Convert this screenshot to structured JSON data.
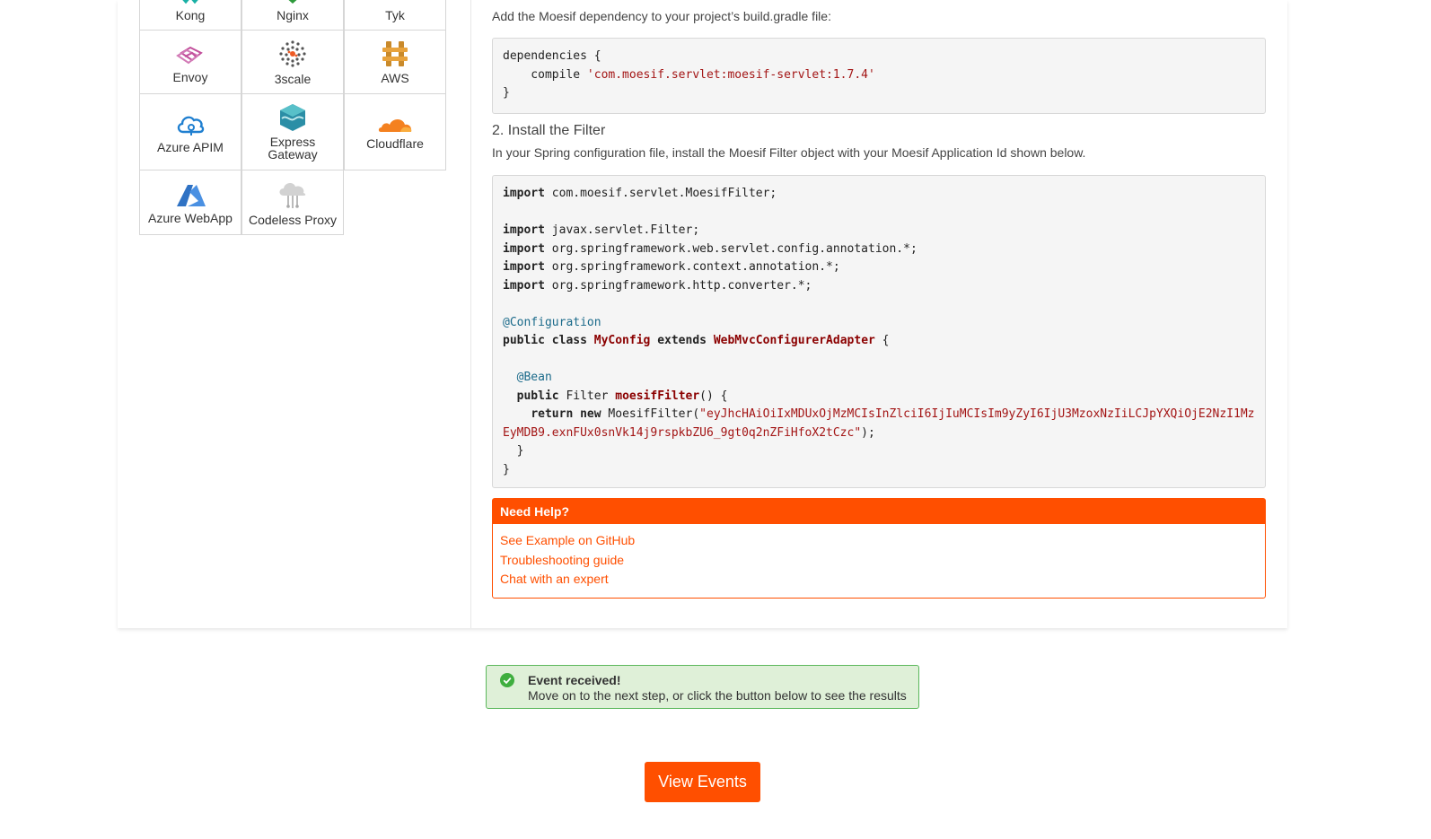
{
  "integrations": [
    {
      "label": "Kong",
      "icon": "kong-icon"
    },
    {
      "label": "Nginx",
      "icon": "nginx-icon"
    },
    {
      "label": "Tyk",
      "icon": "tyk-icon"
    },
    {
      "label": "Envoy",
      "icon": "envoy-icon"
    },
    {
      "label": "3scale",
      "icon": "3scale-icon"
    },
    {
      "label": "AWS",
      "icon": "aws-icon"
    },
    {
      "label": "Azure APIM",
      "icon": "azure-apim-icon"
    },
    {
      "label": "Express Gateway",
      "icon": "express-gateway-icon"
    },
    {
      "label": "Cloudflare",
      "icon": "cloudflare-icon"
    },
    {
      "label": "Azure WebApp",
      "icon": "azure-webapp-icon"
    },
    {
      "label": "Codeless Proxy",
      "icon": "codeless-proxy-icon"
    }
  ],
  "step1": {
    "instruction": "Add the Moesif dependency to your project’s build.gradle file:",
    "code": {
      "l1": "dependencies {",
      "l2_prefix": "    compile ",
      "l2_string": "'com.moesif.servlet:moesif-servlet:1.7.4'",
      "l3": "}"
    }
  },
  "step2": {
    "heading": "2. Install the Filter",
    "instruction": "In your Spring configuration file, install the Moesif Filter object with your Moesif Application Id shown below.",
    "code": {
      "kw_import": "import",
      "imp1": " com.moesif.servlet.MoesifFilter;",
      "imp2": " javax.servlet.Filter;",
      "imp3": " org.springframework.web.servlet.config.annotation.*;",
      "imp4": " org.springframework.context.annotation.*;",
      "imp5": " org.springframework.http.converter.*;",
      "ann_config": "@Configuration",
      "kw_public_class": "public class",
      "class_name": "MyConfig",
      "kw_extends": "extends",
      "parent_class": "WebMvcConfigurerAdapter",
      "open_brace": " {",
      "ann_bean": "@Bean",
      "kw_public": "public",
      "type_filter": " Filter ",
      "method_name": "moesifFilter",
      "method_tail": "() {",
      "kw_return_new": "return new",
      "ctor": " MoesifFilter(",
      "app_id_part1": "\"eyJhcHAiOiIxMDUxOjMzMCIsInZlciI6IjIuMCIsIm9yZyI6IjU3MzoxNzIiLCJpYXQiOjE2NzI1Mz",
      "app_id_part2": "EyMDB9.exnFUx0snVk14j9rspkbZU6_9gt0q2nZFiHfoX2tCzc\"",
      "ctor_close": ");",
      "inner_close": "  }",
      "outer_close": "}"
    }
  },
  "help": {
    "title": "Need Help?",
    "links": [
      "See Example on GitHub",
      "Troubleshooting guide",
      "Chat with an expert"
    ]
  },
  "alert": {
    "title": "Event received!",
    "message": "Move on to the next step, or click the button below to see the results"
  },
  "cta": {
    "label": "View Events"
  },
  "colors": {
    "accent": "#ff4f00",
    "success_bg": "#dff0d8",
    "success_border": "#5cb85c"
  }
}
